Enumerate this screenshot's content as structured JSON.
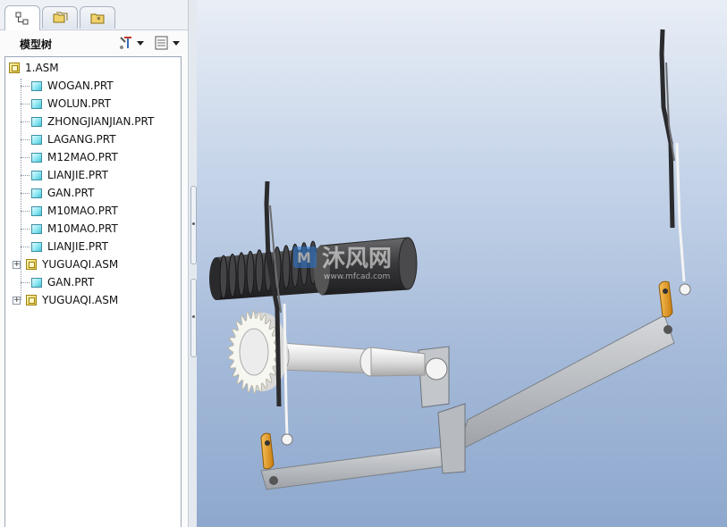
{
  "tabs": [
    {
      "name": "model-tree-tab",
      "icon": "model-tree-icon",
      "active": true
    },
    {
      "name": "folder-browser-tab",
      "icon": "folder-icon",
      "active": false
    },
    {
      "name": "favorites-tab",
      "icon": "favorites-icon",
      "active": false
    }
  ],
  "tree_panel": {
    "title": "模型树",
    "settings_icon": "tree-settings-icon",
    "show_icon": "tree-show-icon"
  },
  "tree": {
    "root": "1.ASM",
    "items": [
      {
        "label": "WOGAN.PRT",
        "type": "part",
        "expandable": false
      },
      {
        "label": "WOLUN.PRT",
        "type": "part",
        "expandable": false
      },
      {
        "label": "ZHONGJIANJIAN.PRT",
        "type": "part",
        "expandable": false
      },
      {
        "label": "LAGANG.PRT",
        "type": "part",
        "expandable": false
      },
      {
        "label": "M12MAO.PRT",
        "type": "part",
        "expandable": false
      },
      {
        "label": "LIANJIE.PRT",
        "type": "part",
        "expandable": false
      },
      {
        "label": "GAN.PRT",
        "type": "part",
        "expandable": false
      },
      {
        "label": "M10MAO.PRT",
        "type": "part",
        "expandable": false
      },
      {
        "label": "M10MAO.PRT",
        "type": "part",
        "expandable": false
      },
      {
        "label": "LIANJIE.PRT",
        "type": "part",
        "expandable": false
      },
      {
        "label": "YUGUAQI.ASM",
        "type": "assembly",
        "expandable": true
      },
      {
        "label": "GAN.PRT",
        "type": "part",
        "expandable": false
      },
      {
        "label": "YUGUAQI.ASM",
        "type": "assembly",
        "expandable": true
      }
    ]
  },
  "watermark": {
    "brand": "沐风网",
    "url": "www.mfcad.com"
  },
  "colors": {
    "viewport_top": "#e9eef6",
    "viewport_bottom": "#8ea8cd",
    "part_gray": "#b9bdc2",
    "bracket_orange": "#e79a1a",
    "worm_dark": "#3d3d3f"
  }
}
